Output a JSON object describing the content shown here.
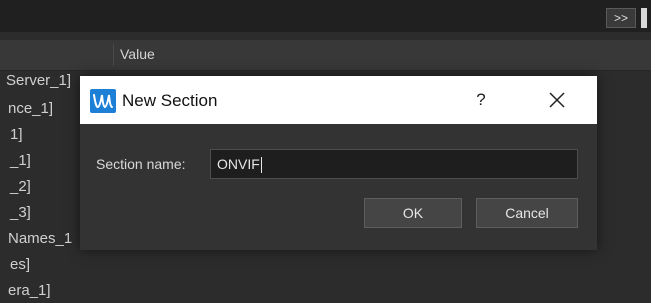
{
  "window": {
    "toolbar_button_label": ">>"
  },
  "table": {
    "value_header": "Value",
    "tree_items": [
      "Server_1]",
      "nce_1]",
      "1]",
      "_1]",
      "_2]",
      "_3]",
      "Names_1",
      "es]",
      "era_1]"
    ]
  },
  "dialog": {
    "title": "New Section",
    "help_label": "?",
    "field_label": "Section name:",
    "field_value": "ONVIF",
    "ok_label": "OK",
    "cancel_label": "Cancel"
  },
  "icons": {
    "app": "app-logo-icon",
    "close": "close-icon"
  },
  "colors": {
    "app_icon": "#1e7fd6",
    "dialog_bg": "#333333",
    "background": "#2c2c2c"
  }
}
